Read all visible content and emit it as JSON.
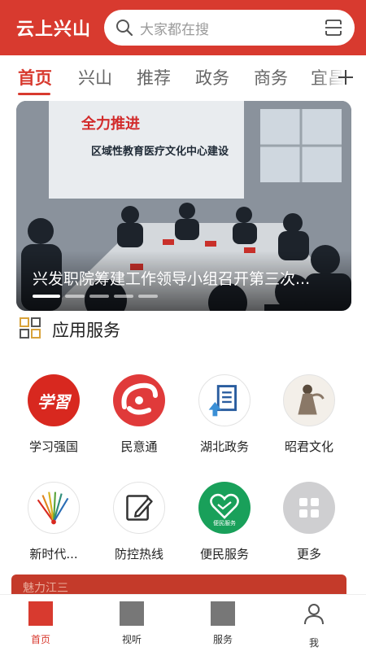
{
  "header": {
    "app_title": "云上兴山",
    "search_placeholder": "大家都在搜"
  },
  "tabs": [
    {
      "label": "首页",
      "active": true
    },
    {
      "label": "兴山"
    },
    {
      "label": "推荐"
    },
    {
      "label": "政务"
    },
    {
      "label": "商务"
    },
    {
      "label": "宜昌"
    }
  ],
  "banner": {
    "caption": "兴发职院筹建工作领导小组召开第三次...",
    "slide_count": 5,
    "active_slide": 1,
    "photo_sign_line1": "全力推进",
    "photo_sign_line2": "区域性教育医疗文化中心建设"
  },
  "services": {
    "title": "应用服务",
    "items": [
      {
        "label": "学习强国",
        "icon": "xuexi-qiangguo-icon",
        "glyph": "学習"
      },
      {
        "label": "民意通",
        "icon": "minyitong-icon"
      },
      {
        "label": "湖北政务",
        "icon": "hubei-gov-document-icon"
      },
      {
        "label": "昭君文化",
        "icon": "zhaojun-statue-icon"
      },
      {
        "label": "新时代...",
        "icon": "new-era-icon"
      },
      {
        "label": "防控热线",
        "icon": "edit-document-icon"
      },
      {
        "label": "便民服务",
        "icon": "convenience-service-icon",
        "glyph": "便民服务"
      },
      {
        "label": "更多",
        "icon": "more-grid-icon"
      }
    ]
  },
  "promo": {
    "text": "魅力江三"
  },
  "bottom_nav": [
    {
      "label": "首页",
      "icon": "home-icon",
      "active": true
    },
    {
      "label": "视听",
      "icon": "video-icon"
    },
    {
      "label": "服务",
      "icon": "service-icon"
    },
    {
      "label": "我",
      "icon": "user-icon"
    }
  ],
  "colors": {
    "brand_red": "#d83a2f",
    "text_dark": "#222222",
    "text_gray": "#666666"
  }
}
